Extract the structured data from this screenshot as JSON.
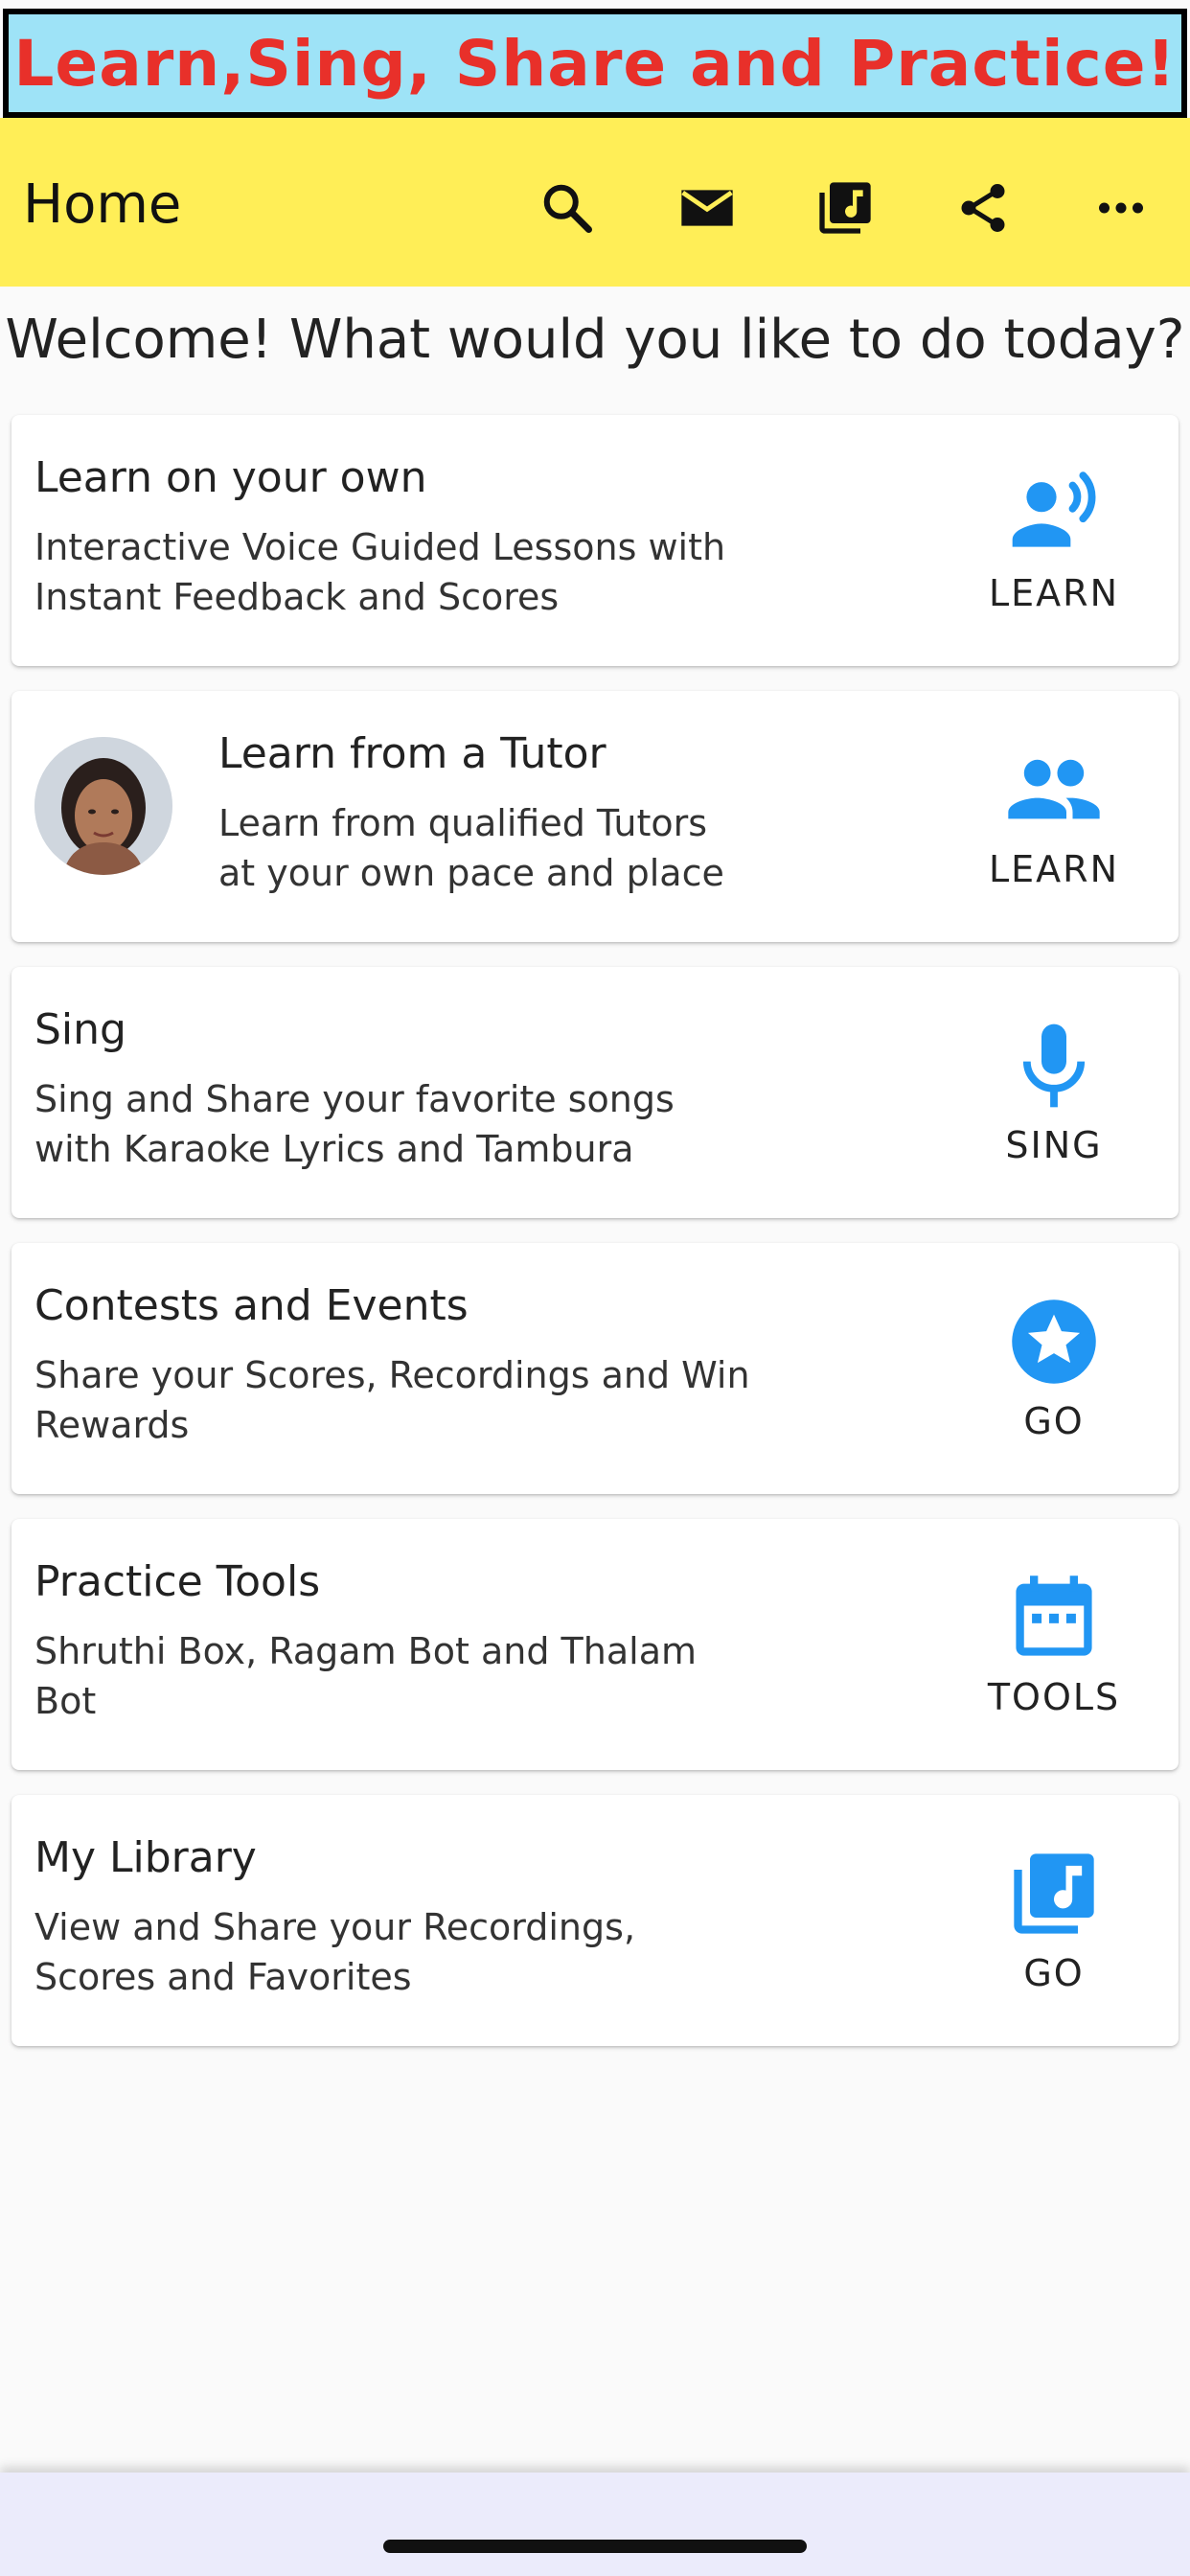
{
  "banner": {
    "text": "Learn,Sing, Share and Practice!"
  },
  "appbar": {
    "title": "Home",
    "icons": [
      "search-icon",
      "mail-icon",
      "music-library-icon",
      "share-icon",
      "more-icon"
    ]
  },
  "welcome": "Welcome! What would you like to do today?",
  "cards": [
    {
      "title": "Learn on your own",
      "subtitle": "Interactive Voice Guided Lessons with Instant Feedback and Scores",
      "action": "LEARN",
      "icon": "voice-speaking-icon"
    },
    {
      "title": "Learn from a Tutor",
      "subtitle": "Learn from qualified Tutors at your own pace and place",
      "action": "LEARN",
      "icon": "people-icon"
    },
    {
      "title": "Sing",
      "subtitle": "Sing and Share your favorite songs with Karaoke Lyrics and Tambura",
      "action": "SING",
      "icon": "microphone-icon"
    },
    {
      "title": "Contests and Events",
      "subtitle": "Share your Scores, Recordings and Win Rewards",
      "action": "GO",
      "icon": "star-circle-icon"
    },
    {
      "title": "Practice Tools",
      "subtitle": "Shruthi Box, Ragam Bot and Thalam Bot",
      "action": "TOOLS",
      "icon": "calendar-icon"
    },
    {
      "title": "My Library",
      "subtitle": "View and Share your Recordings, Scores and Favorites",
      "action": "GO",
      "icon": "music-library-icon"
    }
  ],
  "colors": {
    "banner_bg": "#9ee3f7",
    "banner_text": "#e8302a",
    "appbar_bg": "#ffee57",
    "accent": "#2196f3",
    "nav_bg": "#ebebfb"
  }
}
